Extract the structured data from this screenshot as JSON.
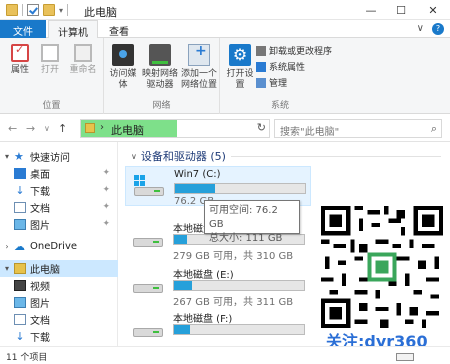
{
  "titlebar": {
    "title": "此电脑",
    "minimize": "—",
    "maximize": "☐",
    "close": "✕"
  },
  "tabs": {
    "file": "文件",
    "computer": "计算机",
    "view": "查看",
    "collapse": "∨"
  },
  "ribbon": {
    "location": {
      "label": "位置",
      "properties": "属性",
      "open": "打开",
      "rename": "重命名"
    },
    "network": {
      "label": "网络",
      "access_media": "访问媒体",
      "map_drive": "映射网络驱动器",
      "add_location": "添加一个网络位置"
    },
    "system": {
      "label": "系统",
      "open_settings": "打开设置",
      "uninstall": "卸载或更改程序",
      "system_properties": "系统属性",
      "manage": "管理"
    }
  },
  "address": {
    "path": "此电脑",
    "search_placeholder": "搜索\"此电脑\"",
    "highlight_color": "#7ee08a"
  },
  "sidebar": {
    "quick_access": "快速访问",
    "items": [
      {
        "label": "桌面",
        "pinned": true
      },
      {
        "label": "下载",
        "pinned": true
      },
      {
        "label": "文档",
        "pinned": true
      },
      {
        "label": "图片",
        "pinned": true
      }
    ],
    "onedrive": "OneDrive",
    "this_pc": "此电脑",
    "pc_items": [
      {
        "label": "视频"
      },
      {
        "label": "图片"
      },
      {
        "label": "文档"
      },
      {
        "label": "下载"
      }
    ]
  },
  "content": {
    "group_title": "设备和驱动器 (5)",
    "drives": [
      {
        "name": "Win7 (C:)",
        "info": "76.2 GB",
        "used_fraction": 0.31,
        "bar_color": "#26a0da"
      },
      {
        "name": "本地磁盘",
        "info": "279 GB 可用，共 310 GB",
        "used_fraction": 0.1,
        "bar_color": "#26a0da"
      },
      {
        "name": "本地磁盘 (E:)",
        "info": "267 GB 可用，共 311 GB",
        "used_fraction": 0.14,
        "bar_color": "#26a0da"
      },
      {
        "name": "本地磁盘 (F:)",
        "info": "",
        "used_fraction": 0.12,
        "bar_color": "#26a0da"
      }
    ],
    "tooltip": {
      "free": "可用空间: 76.2 GB",
      "total": "总大小: 111 GB"
    }
  },
  "watermark": {
    "text": "关注:dyr360",
    "color": "#2b6fd6"
  },
  "status": {
    "count": "11 个项目"
  }
}
